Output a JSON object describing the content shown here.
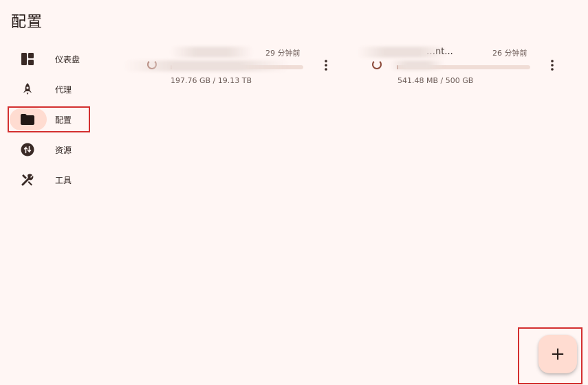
{
  "page": {
    "title": "配置"
  },
  "sidebar": {
    "items": [
      {
        "label": "仪表盘",
        "icon": "dashboard-icon"
      },
      {
        "label": "代理",
        "icon": "rocket-icon"
      },
      {
        "label": "配置",
        "icon": "folder-icon",
        "active": true
      },
      {
        "label": "资源",
        "icon": "swap-vert-icon"
      },
      {
        "label": "工具",
        "icon": "tools-icon"
      }
    ]
  },
  "profiles": [
    {
      "name": "",
      "updated": "29 分钟前",
      "usage": "197.76 GB / 19.13 TB",
      "progress": 0.01
    },
    {
      "name": "…nt...",
      "updated": "26 分钟前",
      "usage": "541.48 MB / 500 GB",
      "progress": 0.001
    }
  ],
  "fab": {
    "label": "+"
  },
  "colors": {
    "background": "#fff6f4",
    "accent": "#ffdcd1",
    "primary": "#8c4a3a",
    "highlight_box": "#d32f2f"
  }
}
